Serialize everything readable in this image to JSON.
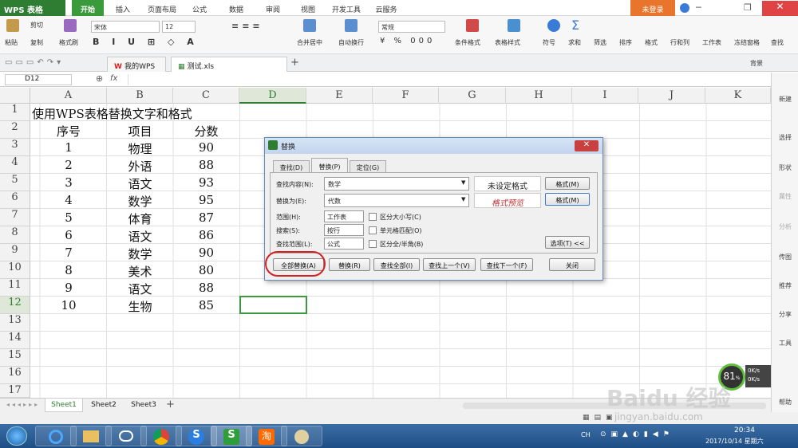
{
  "app": {
    "name": "WPS 表格",
    "login": "未登录"
  },
  "menu": [
    "开始",
    "插入",
    "页面布局",
    "公式",
    "数据",
    "审阅",
    "视图",
    "开发工具",
    "云服务"
  ],
  "ribbon": {
    "paste": "粘贴",
    "cut": "剪切",
    "copy": "复制",
    "format_painter": "格式刷",
    "font": "宋体",
    "size": "12",
    "number_format": "常规",
    "merge": "合并居中",
    "wrap": "自动换行",
    "cond_format": "条件格式",
    "table_style": "表格样式",
    "symbol": "符号",
    "sum": "求和",
    "filter": "筛选",
    "sort": "排序",
    "format": "格式",
    "rowcol": "行和列",
    "sheet": "工作表",
    "freeze": "冻结窗格",
    "find": "查找"
  },
  "tabs": {
    "home": "我的WPS",
    "file": "测试.xls",
    "bg": "背景"
  },
  "formula": {
    "name_box": "D12",
    "fx": "fx"
  },
  "columns": [
    "A",
    "B",
    "C",
    "D",
    "E",
    "F",
    "G",
    "H",
    "I",
    "J",
    "K"
  ],
  "rows": [
    "1",
    "2",
    "3",
    "4",
    "5",
    "6",
    "7",
    "8",
    "9",
    "10",
    "11",
    "12",
    "13",
    "14",
    "15",
    "16",
    "17"
  ],
  "sheet": {
    "title": "使用WPS表格替换文字和格式",
    "headers": [
      "序号",
      "项目",
      "分数"
    ],
    "data": [
      [
        "1",
        "物理",
        "90"
      ],
      [
        "2",
        "外语",
        "88"
      ],
      [
        "3",
        "语文",
        "93"
      ],
      [
        "4",
        "数学",
        "95"
      ],
      [
        "5",
        "体育",
        "87"
      ],
      [
        "6",
        "语文",
        "86"
      ],
      [
        "7",
        "数学",
        "90"
      ],
      [
        "8",
        "美术",
        "80"
      ],
      [
        "9",
        "语文",
        "88"
      ],
      [
        "10",
        "生物",
        "85"
      ]
    ]
  },
  "dialog": {
    "title": "替换",
    "tabs": [
      "查找(D)",
      "替换(P)",
      "定位(G)"
    ],
    "find_label": "查找内容(N):",
    "find_value": "数学",
    "no_format": "未设定格式",
    "format_btn": "格式(M)",
    "replace_label": "替换为(E):",
    "replace_value": "代数",
    "preview": "格式预览",
    "range_label": "范围(H):",
    "range_value": "工作表",
    "search_label": "搜索(S):",
    "search_value": "按行",
    "lookin_label": "查找范围(L):",
    "lookin_value": "公式",
    "opt_case": "区分大小写(C)",
    "opt_whole": "单元格匹配(O)",
    "opt_width": "区分全/半角(B)",
    "options_btn": "选项(T) <<",
    "btn_replace_all": "全部替换(A)",
    "btn_replace": "替换(R)",
    "btn_find_all": "查找全部(I)",
    "btn_prev": "查找上一个(V)",
    "btn_next": "查找下一个(F)",
    "btn_close": "关闭"
  },
  "right_panel": [
    "新建",
    "选择",
    "形状",
    "属性",
    "分析",
    "传图",
    "推荐",
    "分享",
    "工具",
    "帮助"
  ],
  "sheet_tabs": [
    "Sheet1",
    "Sheet2",
    "Sheet3"
  ],
  "perf": {
    "percent": "81",
    "pct_sign": "%",
    "up": "0K/s",
    "down": "0K/s"
  },
  "watermark": "Baidu 经验",
  "watermark_url": "jingyan.baidu.com",
  "tray": {
    "lang": "CH",
    "time": "20:34",
    "date": "2017/10/14 星期六"
  },
  "colors": {
    "app_green": "#2e7d32",
    "login_orange": "#e8752b",
    "select_green": "#3a9a3c",
    "annot_red": "#d42020"
  }
}
